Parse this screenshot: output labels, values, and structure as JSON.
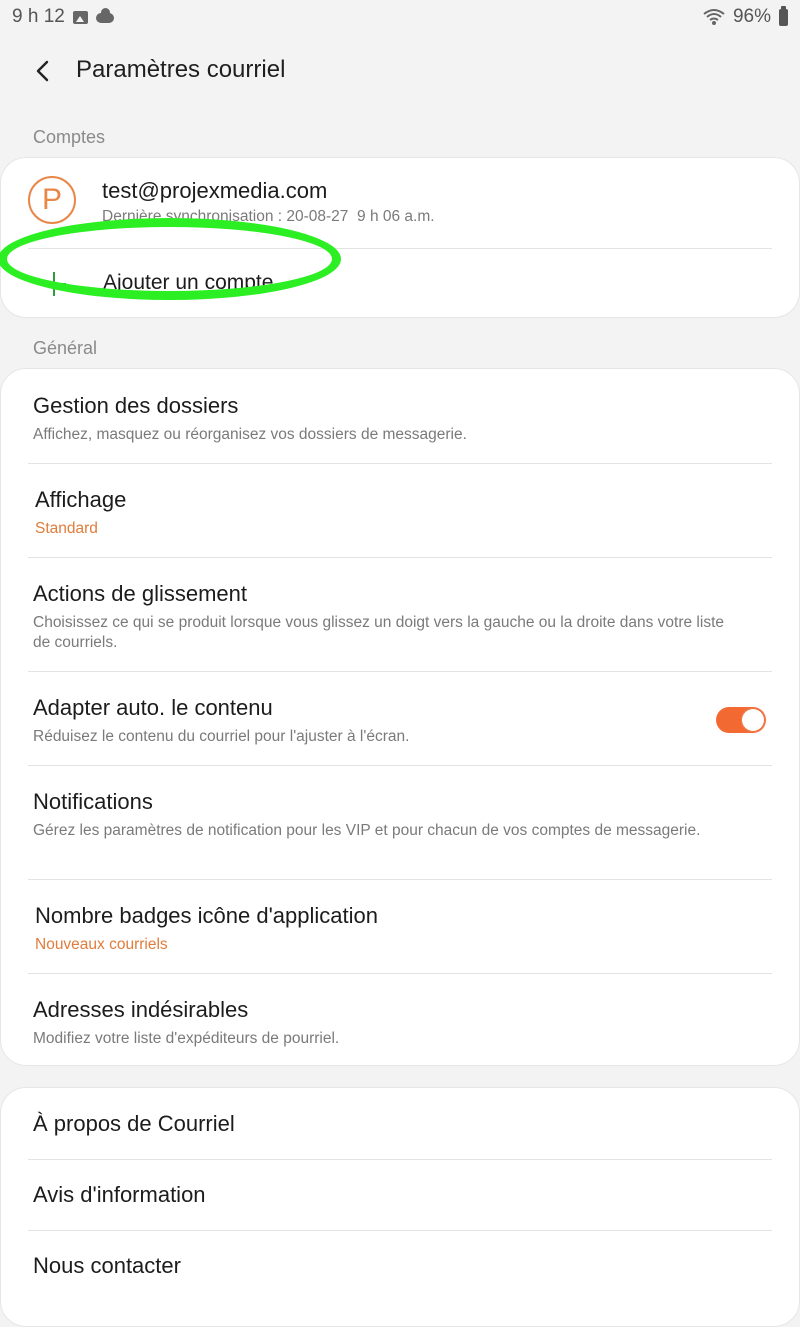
{
  "status_bar": {
    "time": "9 h 12",
    "battery": "96%",
    "icons": [
      "image-icon",
      "cloud-icon",
      "wifi-icon",
      "battery-icon"
    ]
  },
  "header": {
    "back_icon": "chevron-left-icon",
    "title": "Paramètres courriel"
  },
  "accounts_section": {
    "label": "Comptes",
    "account": {
      "avatar_letter": "P",
      "email": "test@projexmedia.com",
      "sync": "Dernière synchronisation : 20-08-27  9 h 06 a.m."
    },
    "add_account": "Ajouter un compte"
  },
  "general_section": {
    "label": "Général",
    "items": [
      {
        "title": "Gestion des dossiers",
        "subtitle": "Affichez, masquez ou réorganisez vos dossiers de messagerie."
      },
      {
        "title": "Affichage",
        "subtitle": "Standard"
      },
      {
        "title": "Actions de glissement",
        "subtitle": "Choisissez ce qui se produit lorsque vous glissez un doigt vers la gauche ou la droite dans votre liste de courriels."
      },
      {
        "title": "Adapter auto. le contenu",
        "subtitle": "Réduisez le contenu du courriel pour l'ajuster à l'écran.",
        "toggle_on": true
      },
      {
        "title": "Notifications",
        "subtitle": "Gérez les paramètres de notification pour les VIP et pour chacun de vos comptes de messagerie."
      },
      {
        "title": "Nombre badges icône d'application",
        "subtitle": "Nouveaux courriels"
      },
      {
        "title": "Adresses indésirables",
        "subtitle": "Modifiez votre liste d'expéditeurs de pourriel."
      }
    ]
  },
  "about_section": {
    "items": [
      "À propos de Courriel",
      "Avis d'information",
      "Nous contacter"
    ]
  },
  "colors": {
    "accent": "#f26a32",
    "value_orange": "#e07c3c",
    "highlight_green": "#2bef22",
    "plus_green": "#2e9e3a"
  }
}
